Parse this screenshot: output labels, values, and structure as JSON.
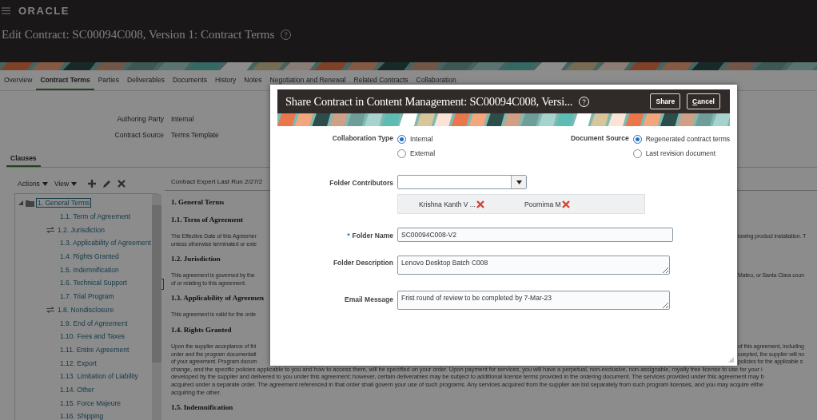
{
  "brand": {
    "logo": "ORACLE"
  },
  "page_title": "Edit Contract: SC00094C008, Version 1: Contract Terms",
  "tabs": [
    {
      "label": "Overview",
      "selected": false
    },
    {
      "label": "Contract Terms",
      "selected": true
    },
    {
      "label": "Parties",
      "selected": false
    },
    {
      "label": "Deliverables",
      "selected": false
    },
    {
      "label": "Documents",
      "selected": false
    },
    {
      "label": "History",
      "selected": false
    },
    {
      "label": "Notes",
      "selected": false
    },
    {
      "label": "Negotiation and Renewal",
      "selected": false
    },
    {
      "label": "Related Contracts",
      "selected": false
    },
    {
      "label": "Collaboration",
      "selected": false
    }
  ],
  "info": [
    {
      "label": "Authoring Party",
      "value": "Internal"
    },
    {
      "label": "Contract Source",
      "value": "Terms Template"
    }
  ],
  "section_tab": {
    "label": "Clauses",
    "selected": true
  },
  "clause_toolbar": {
    "menus": [
      "Actions",
      "View"
    ]
  },
  "clause_tree": [
    {
      "label": "1. General Terms",
      "selected": true,
      "expanded": true,
      "children": [
        {
          "label": "1.1. Term of Agreement",
          "selected": false,
          "alternate": false
        },
        {
          "label": "1.2. Jurisdiction",
          "selected": false,
          "alternate": true
        },
        {
          "label": "1.3. Applicability of Agreement",
          "selected": false,
          "alternate": false
        },
        {
          "label": "1.4. Rights Granted",
          "selected": false,
          "alternate": false
        },
        {
          "label": "1.5. Indemnification",
          "selected": false,
          "alternate": false
        },
        {
          "label": "1.6. Technical Support",
          "selected": false,
          "alternate": false
        },
        {
          "label": "1.7. Trial Program",
          "selected": false,
          "alternate": false
        },
        {
          "label": "1.8. Nondisclosure",
          "selected": false,
          "alternate": true
        },
        {
          "label": "1.9. End of Agreement",
          "selected": false,
          "alternate": false
        },
        {
          "label": "1.10. Fees and Taxes",
          "selected": false,
          "alternate": false
        },
        {
          "label": "1.11. Entire Agreement",
          "selected": false,
          "alternate": false
        },
        {
          "label": "1.12. Export",
          "selected": false,
          "alternate": false
        },
        {
          "label": "1.13. Limitation of Liability",
          "selected": false,
          "alternate": false
        },
        {
          "label": "1.14. Other",
          "selected": false,
          "alternate": false
        },
        {
          "label": "1.15. Force Majeure",
          "selected": false,
          "alternate": false
        },
        {
          "label": "1.16. Shipping",
          "selected": false,
          "alternate": false
        }
      ]
    }
  ],
  "document": {
    "header": "Contract Expert Last Run  2/27/2",
    "blocks": [
      {
        "kind": "heading",
        "text": "1. General Terms"
      },
      {
        "kind": "heading",
        "text": "1.1. Term of Agreement"
      },
      {
        "kind": "split",
        "left": "The Effective Date of this Agreemer",
        "right": "lowing product installation. T"
      },
      {
        "kind": "split",
        "left": "unless otherwise terminated or exte"
      },
      {
        "kind": "heading",
        "text": "1.2. Jurisdiction"
      },
      {
        "kind": "split",
        "left": "This agreement is governed by the",
        "right": "Mateo, or Santa Clara coun"
      },
      {
        "kind": "split",
        "left": "of or relating to this agreement."
      },
      {
        "kind": "heading",
        "text": "1.3. Applicability of Agreemen"
      },
      {
        "kind": "split",
        "left": "This agreement is valid for the orde"
      },
      {
        "kind": "heading",
        "text": "1.4. Rights Granted"
      },
      {
        "kind": "split",
        "left": "Upon the supplier acceptance of thi",
        "right": "of this agreement, including"
      },
      {
        "kind": "split",
        "left": "order and the program documentati",
        "right": "ccepted, the supplier will no"
      },
      {
        "kind": "split",
        "left": "of your agreement. Program docum",
        "right": "policies for the applicable s"
      },
      {
        "kind": "full",
        "text": "change, and the specific policies applicable to you and how to access them, will be specified on your order. Upon payment for services, you will have a perpetual, non-exclusive, non-assignable, royalty free license to use for your i"
      },
      {
        "kind": "full",
        "text": "developed by the supplier and delivered to you under this agreement; however, certain deliverables may be subject to additional license terms provided in the ordering document. The services provided under this agreement may b"
      },
      {
        "kind": "full",
        "text": "acquired under a separate order. The agreement referenced in that order shall govern your use of such programs. Any services acquired from the supplier are bid separately from such program licenses, and you may acquire eithe"
      },
      {
        "kind": "full",
        "text": "acquiring the other."
      },
      {
        "kind": "heading",
        "text": "1.5. Indemnification"
      }
    ]
  },
  "dialog": {
    "title": "Share Contract in Content Management: SC00094C008, Versi...",
    "buttons": [
      {
        "label": "Share",
        "kind": "primary"
      },
      {
        "label": "Cancel",
        "kind": "cancel"
      }
    ],
    "collaboration_type": {
      "label": "Collaboration Type",
      "options": [
        {
          "label": "Internal",
          "selected": true
        },
        {
          "label": "External",
          "selected": false
        }
      ]
    },
    "document_source": {
      "label": "Document Source",
      "options": [
        {
          "label": "Regenerated contract terms",
          "selected": true
        },
        {
          "label": "Last revision document",
          "selected": false
        }
      ]
    },
    "folder_contributors": {
      "label": "Folder Contributors",
      "chips": [
        "Krishna Kanth V ...",
        "Poornima M"
      ]
    },
    "folder_name": {
      "label": "Folder Name",
      "required_mark": "*",
      "value": "SC00094C008-V2"
    },
    "folder_description": {
      "label": "Folder Description",
      "value": "Lenovo Desktop Batch C008"
    },
    "email_message": {
      "label": "Email Message",
      "value": "Frist round of review to be completed by 7-Mar-23"
    }
  }
}
